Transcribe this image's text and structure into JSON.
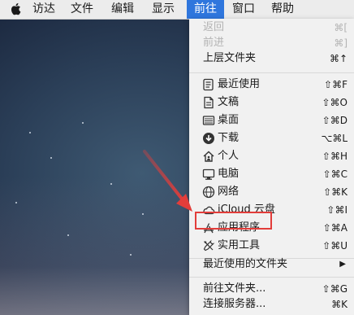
{
  "menubar": {
    "items": [
      "访达",
      "文件",
      "编辑",
      "显示",
      "前往",
      "窗口",
      "帮助"
    ],
    "active_index": 4
  },
  "go_menu": {
    "items": [
      {
        "label": "返回",
        "shortcut": "⌘[",
        "enabled": false
      },
      {
        "label": "前进",
        "shortcut": "⌘]",
        "enabled": false
      },
      {
        "label": "上层文件夹",
        "shortcut": "⌘↑",
        "enabled": true
      },
      {
        "label": "最近使用",
        "shortcut": "⇧⌘F",
        "icon": "recents-icon"
      },
      {
        "label": "文稿",
        "shortcut": "⇧⌘O",
        "icon": "documents-icon"
      },
      {
        "label": "桌面",
        "shortcut": "⇧⌘D",
        "icon": "desktop-icon"
      },
      {
        "label": "下载",
        "shortcut": "⌥⌘L",
        "icon": "downloads-icon"
      },
      {
        "label": "个人",
        "shortcut": "⇧⌘H",
        "icon": "home-icon"
      },
      {
        "label": "电脑",
        "shortcut": "⇧⌘C",
        "icon": "computer-icon"
      },
      {
        "label": "网络",
        "shortcut": "⇧⌘K",
        "icon": "network-icon"
      },
      {
        "label": "iCloud 云盘",
        "shortcut": "⇧⌘I",
        "icon": "icloud-icon"
      },
      {
        "label": "应用程序",
        "shortcut": "⇧⌘A",
        "icon": "applications-icon",
        "highlighted": true
      },
      {
        "label": "实用工具",
        "shortcut": "⇧⌘U",
        "icon": "utilities-icon"
      },
      {
        "label": "最近使用的文件夹",
        "shortcut": "▶",
        "submenu": true
      },
      {
        "label": "前往文件夹...",
        "shortcut": "⇧⌘G"
      },
      {
        "label": "连接服务器...",
        "shortcut": "⌘K"
      }
    ]
  },
  "colors": {
    "menubar_bg": "#ececec",
    "active_menu": "#2f76dd",
    "menu_bg": "#f1f1f1",
    "annotation_red": "#e23d3a"
  }
}
